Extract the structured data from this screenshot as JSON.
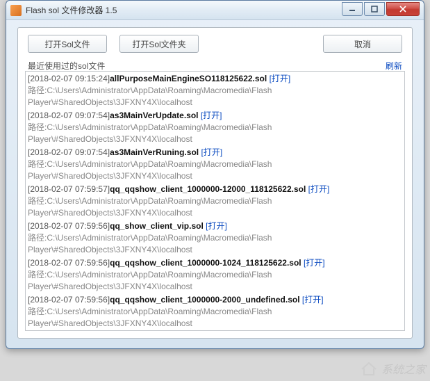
{
  "window": {
    "title": "Flash sol 文件修改器 1.5"
  },
  "toolbar": {
    "open_file_label": "打开Sol文件",
    "open_folder_label": "打开Sol文件夹",
    "cancel_label": "取消"
  },
  "section": {
    "title": "最近使用过的sol文件",
    "refresh_label": "刷新",
    "open_link_label": "[打开]",
    "path_prefix": "路径:"
  },
  "entries": [
    {
      "timestamp": "[2018-02-07 09:15:24]",
      "filename": "allPurposeMainEngineSO118125622.sol",
      "path": "C:\\Users\\Administrator\\AppData\\Roaming\\Macromedia\\Flash Player\\#SharedObjects\\3JFXNY4X\\localhost"
    },
    {
      "timestamp": "[2018-02-07 09:07:54]",
      "filename": "as3MainVerUpdate.sol",
      "path": "C:\\Users\\Administrator\\AppData\\Roaming\\Macromedia\\Flash Player\\#SharedObjects\\3JFXNY4X\\localhost"
    },
    {
      "timestamp": "[2018-02-07 09:07:54]",
      "filename": "as3MainVerRuning.sol",
      "path": "C:\\Users\\Administrator\\AppData\\Roaming\\Macromedia\\Flash Player\\#SharedObjects\\3JFXNY4X\\localhost"
    },
    {
      "timestamp": "[2018-02-07 07:59:57]",
      "filename": "qq_qqshow_client_1000000-12000_118125622.sol",
      "path": "C:\\Users\\Administrator\\AppData\\Roaming\\Macromedia\\Flash Player\\#SharedObjects\\3JFXNY4X\\localhost"
    },
    {
      "timestamp": "[2018-02-07 07:59:56]",
      "filename": "qq_show_client_vip.sol",
      "path": "C:\\Users\\Administrator\\AppData\\Roaming\\Macromedia\\Flash Player\\#SharedObjects\\3JFXNY4X\\localhost"
    },
    {
      "timestamp": "[2018-02-07 07:59:56]",
      "filename": "qq_qqshow_client_1000000-1024_118125622.sol",
      "path": "C:\\Users\\Administrator\\AppData\\Roaming\\Macromedia\\Flash Player\\#SharedObjects\\3JFXNY4X\\localhost"
    },
    {
      "timestamp": "[2018-02-07 07:59:56]",
      "filename": "qq_qqshow_client_1000000-2000_undefined.sol",
      "path": "C:\\Users\\Administrator\\AppData\\Roaming\\Macromedia\\Flash Player\\#SharedObjects\\3JFXNY4X\\localhost"
    }
  ],
  "watermark": "系统之家"
}
